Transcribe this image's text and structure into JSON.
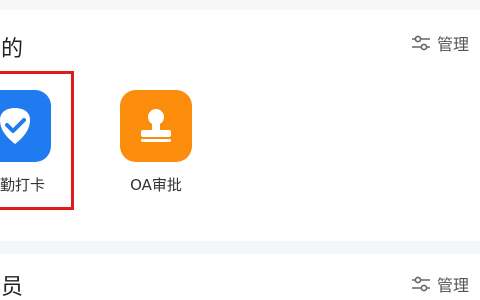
{
  "sections": [
    {
      "title": "我的",
      "manage_label": "管理",
      "apps": [
        {
          "label": "考勤打卡",
          "icon": "check-shield-icon",
          "color": "#1e7bf0"
        },
        {
          "label": "OA审批",
          "icon": "stamp-icon",
          "color": "#fb8c0c"
        }
      ],
      "highlighted_app_index": 0
    },
    {
      "title": "会员",
      "manage_label": "管理"
    }
  ],
  "colors": {
    "highlight": "#e01b1b",
    "blue": "#1e7bf0",
    "orange": "#fb8c0c"
  }
}
